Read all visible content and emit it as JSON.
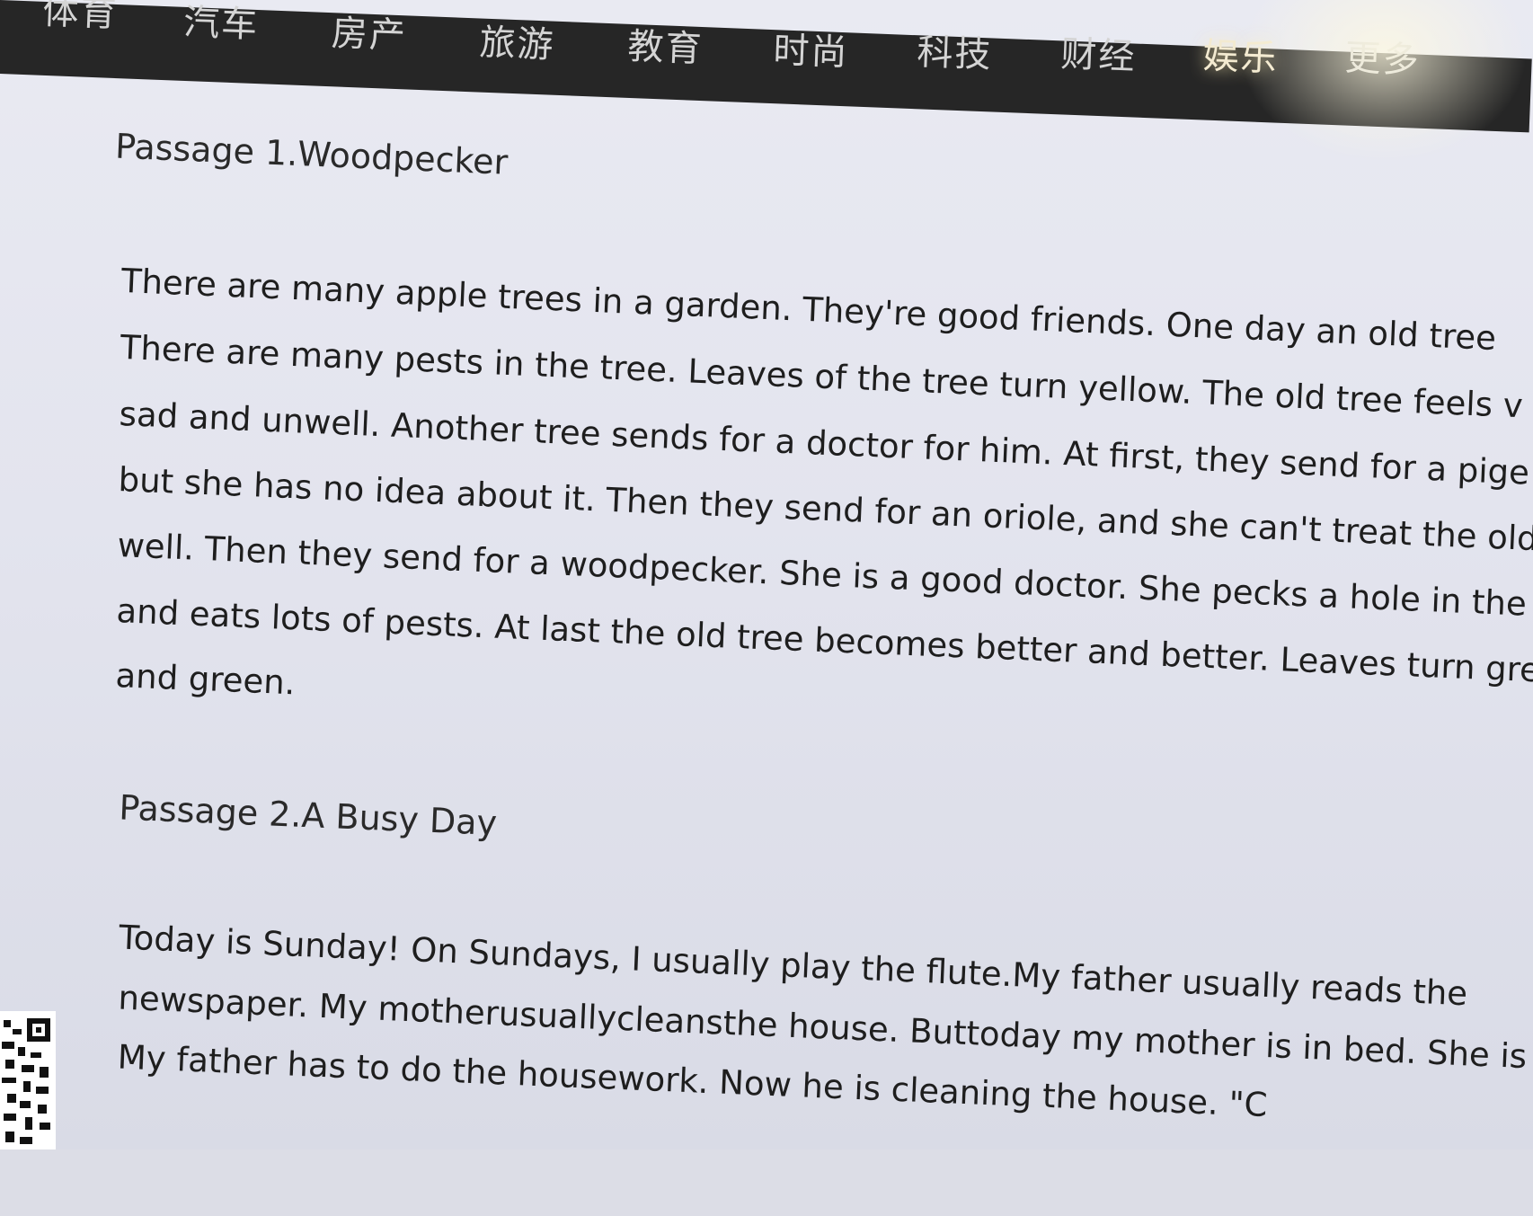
{
  "nav": {
    "items": [
      "体育",
      "汽车",
      "房产",
      "旅游",
      "教育",
      "时尚",
      "科技",
      "财经",
      "娱乐",
      "更多"
    ]
  },
  "passage1": {
    "title": "Passage 1.Woodpecker",
    "lines": [
      "There are many apple trees in a garden. They're good friends. One day an old tree",
      "There are many pests in the tree. Leaves of the tree turn yellow. The old tree feels v",
      "sad and unwell. Another tree sends for a doctor for him. At first, they send for a pige",
      "but she has no idea about it. Then they send for an oriole, and she can't treat the old",
      "well. Then they send for a woodpecker. She is a good doctor. She pecks a hole in the",
      "and eats lots of pests. At last the old tree becomes better and better. Leaves turn gre",
      "and green."
    ]
  },
  "passage2": {
    "title": "Passage 2.A Busy Day",
    "lines": [
      "Today is Sunday! On Sundays, I usually play the flute.My father usually reads the",
      "newspaper. My motherusuallycleansthe house. Buttoday my mother is in bed. She is ill.",
      "My father has to do the housework. Now he is cleaning the house. \"C"
    ]
  }
}
